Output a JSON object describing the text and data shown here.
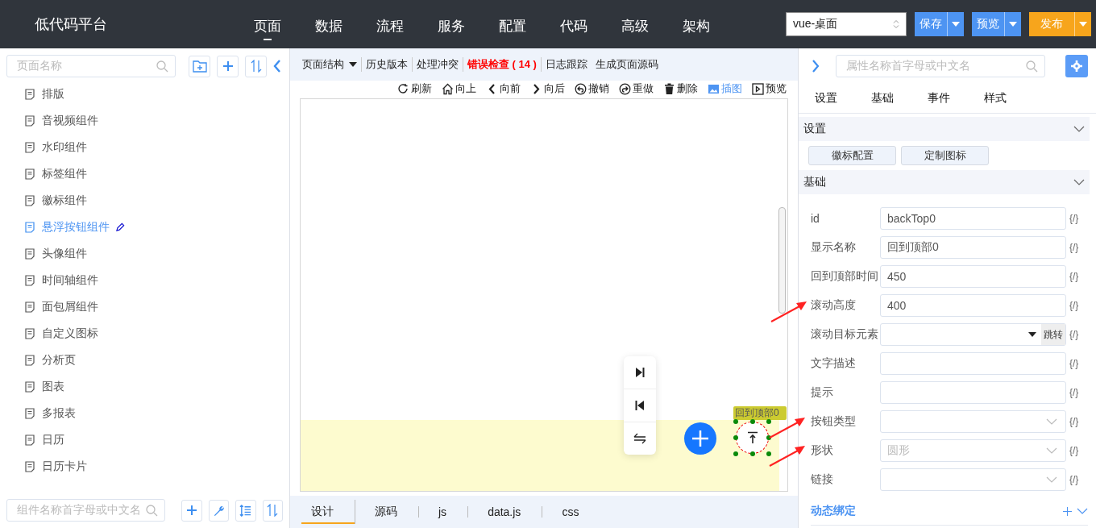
{
  "header": {
    "logo": "低代码平台",
    "nav": [
      {
        "label": "页面",
        "selected": true
      },
      {
        "label": "数据",
        "selected": false
      },
      {
        "label": "流程",
        "selected": false
      },
      {
        "label": "服务",
        "selected": false
      },
      {
        "label": "配置",
        "selected": false
      },
      {
        "label": "代码",
        "selected": false
      },
      {
        "label": "高级",
        "selected": false
      },
      {
        "label": "架构",
        "selected": false
      }
    ],
    "env_select": {
      "value": "vue-桌面"
    },
    "buttons": [
      {
        "label": "保存",
        "kind": "primary"
      },
      {
        "label": "预览",
        "kind": "primary"
      },
      {
        "label": "发布",
        "kind": "warning"
      }
    ]
  },
  "sidebar": {
    "search": {
      "placeholder": "页面名称"
    },
    "items": [
      {
        "label": "排版",
        "selected": false
      },
      {
        "label": "音视频组件",
        "selected": false
      },
      {
        "label": "水印组件",
        "selected": false
      },
      {
        "label": "标签组件",
        "selected": false
      },
      {
        "label": "徽标组件",
        "selected": false
      },
      {
        "label": "悬浮按钮组件",
        "selected": true
      },
      {
        "label": "头像组件",
        "selected": false
      },
      {
        "label": "时间轴组件",
        "selected": false
      },
      {
        "label": "面包屑组件",
        "selected": false
      },
      {
        "label": "自定义图标",
        "selected": false
      },
      {
        "label": "分析页",
        "selected": false
      },
      {
        "label": "图表",
        "selected": false
      },
      {
        "label": "多报表",
        "selected": false
      },
      {
        "label": "日历",
        "selected": false
      },
      {
        "label": "日历卡片",
        "selected": false
      }
    ],
    "component_search": {
      "placeholder": "组件名称首字母或中文名"
    }
  },
  "editor": {
    "toolbar": [
      {
        "label": "页面结构",
        "kind": "dropdown"
      },
      {
        "label": "历史版本",
        "kind": "plain"
      },
      {
        "label": "处理冲突",
        "kind": "plain"
      },
      {
        "label": "错误检查 ( 14 )",
        "kind": "error"
      },
      {
        "label": "日志跟踪",
        "kind": "plain"
      },
      {
        "label": "生成页面源码",
        "kind": "plain"
      }
    ],
    "actions": [
      {
        "label": "刷新",
        "kind": "refresh",
        "active": false
      },
      {
        "label": "向上",
        "kind": "home",
        "active": false
      },
      {
        "label": "向前",
        "kind": "left",
        "active": false
      },
      {
        "label": "向后",
        "kind": "right",
        "active": false
      },
      {
        "label": "撤销",
        "kind": "undo",
        "active": false
      },
      {
        "label": "重做",
        "kind": "redo",
        "active": false
      },
      {
        "label": "删除",
        "kind": "trash",
        "active": false
      },
      {
        "label": "插图",
        "kind": "image",
        "active": true
      },
      {
        "label": "预览",
        "kind": "play",
        "active": false
      }
    ],
    "canvas": {
      "back_top_label": "回到顶部0"
    },
    "tabs": [
      {
        "label": "设计",
        "selected": true
      },
      {
        "label": "源码",
        "selected": false
      },
      {
        "label": "js",
        "selected": false
      },
      {
        "label": "data.js",
        "selected": false
      },
      {
        "label": "css",
        "selected": false
      }
    ]
  },
  "properties": {
    "search": {
      "placeholder": "属性名称首字母或中文名"
    },
    "tabs": [
      "设置",
      "基础",
      "事件",
      "样式"
    ],
    "settings_section": {
      "title": "设置",
      "buttons": [
        "徽标配置",
        "定制图标"
      ]
    },
    "basic_section": {
      "title": "基础",
      "fields": [
        {
          "label": "id",
          "kind": "input",
          "value": "backTop0",
          "binding": "{/}"
        },
        {
          "label": "显示名称",
          "kind": "input",
          "value": "回到顶部0",
          "binding": "{/}"
        },
        {
          "label": "回到顶部时间",
          "kind": "input",
          "value": "450",
          "binding": "{/}"
        },
        {
          "label": "滚动高度",
          "kind": "input",
          "value": "400",
          "binding": "{/}"
        },
        {
          "label": "滚动目标元素",
          "kind": "jump_select",
          "button": "跳转",
          "binding": "{/}"
        },
        {
          "label": "文字描述",
          "kind": "input",
          "binding": "{/}"
        },
        {
          "label": "提示",
          "kind": "input",
          "binding": "{/}"
        },
        {
          "label": "按钮类型",
          "kind": "select",
          "binding": "{/}"
        },
        {
          "label": "形状",
          "kind": "select",
          "placeholder": "圆形",
          "binding": "{/}"
        },
        {
          "label": "链接",
          "kind": "select",
          "binding": "{/}"
        }
      ]
    },
    "dynamic_binding": {
      "label": "动态绑定"
    }
  }
}
